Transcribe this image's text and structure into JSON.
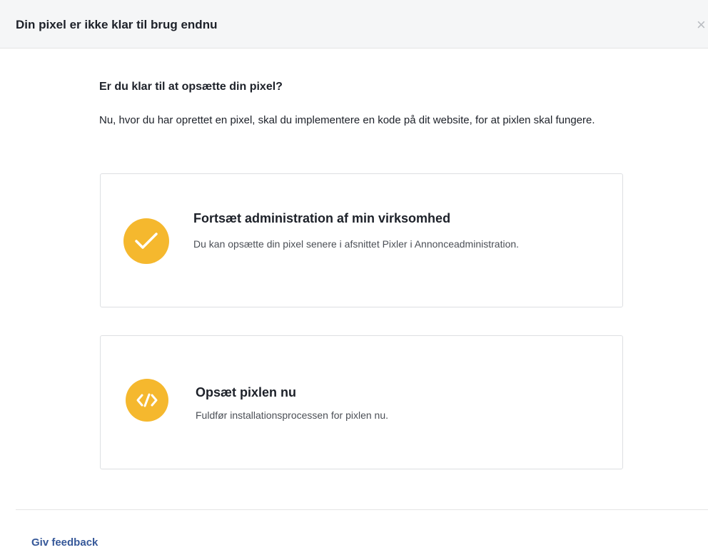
{
  "dialog": {
    "title": "Din pixel er ikke klar til brug endnu",
    "close_icon": "close-icon",
    "close_glyph": "×"
  },
  "main": {
    "question": "Er du klar til at opsætte din pixel?",
    "intro": "Nu, hvor du har oprettet en pixel, skal du implementere en kode på dit website, for at pixlen skal fungere."
  },
  "options": [
    {
      "icon": "checkmark-icon",
      "title": "Fortsæt administration af min virksomhed",
      "description": "Du kan opsætte din pixel senere i afsnittet Pixler i Annonceadministration."
    },
    {
      "icon": "code-icon",
      "title": "Opsæt pixlen nu",
      "description": "Fuldfør installationsprocessen for pixlen nu."
    }
  ],
  "footer": {
    "feedback_label": "Giv feedback"
  },
  "colors": {
    "accent_icon": "#f5b82e",
    "link": "#365899",
    "header_bg": "#f5f6f7",
    "card_border": "#dddfe2"
  }
}
